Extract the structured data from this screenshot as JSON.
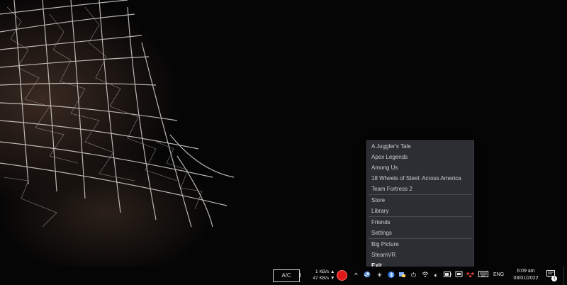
{
  "steam_menu": {
    "recent_games": [
      "A Juggler's Tale",
      "Apex Legends",
      "Among Us",
      "18 Wheels of Steel: Across America",
      "Team Fortress 2"
    ],
    "store": "Store",
    "library": "Library",
    "friends": "Friends",
    "settings": "Settings",
    "big_picture": "Big Picture",
    "steamvr": "SteamVR",
    "exit": "Exit"
  },
  "taskbar": {
    "battery_label": "A/C",
    "net_up": "1 KB/s",
    "net_down": "47 KB/s",
    "language": "ENG",
    "time": "6:09 am",
    "date": "03/01/2022",
    "notification_count": "1",
    "record_color": "#e01818"
  },
  "icons": {
    "overflow": "chevron-up-icon",
    "steam": "steam-icon",
    "brightness": "brightness-icon",
    "bluetooth": "bluetooth-icon",
    "app_tray": "app-tray-icon",
    "power": "power-icon",
    "wifi": "wifi-icon",
    "volume": "volume-icon",
    "battery": "battery-icon",
    "onedrive": "cloud-icon",
    "dropbox": "dropbox-icon",
    "keyboard": "keyboard-icon",
    "notifications": "notifications-icon"
  }
}
